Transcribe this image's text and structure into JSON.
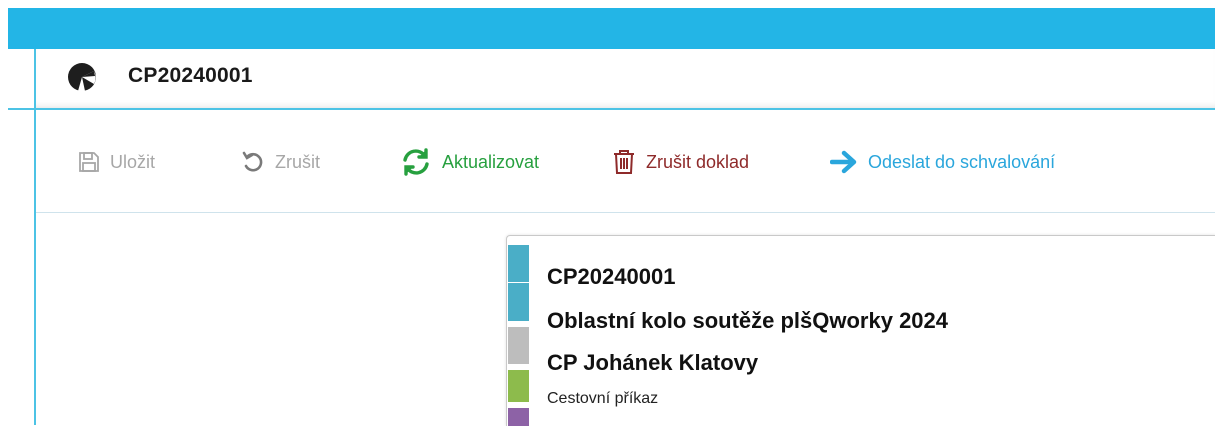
{
  "header": {
    "document_title": "CP20240001",
    "logo_icon": "company-logo-icon"
  },
  "toolbar": {
    "save_label": "Uložit",
    "cancel_label": "Zrušit",
    "refresh_label": "Aktualizovat",
    "delete_label": "Zrušit doklad",
    "send_label": "Odeslat do schvalování",
    "colors": {
      "disabled": "#a7a7a7",
      "refresh": "#27a03f",
      "delete": "#8e2a2a",
      "send": "#2aa6dc"
    }
  },
  "card": {
    "code": "CP20240001",
    "name": "Oblastní kolo soutěže plšQworky 2024",
    "organization": "CP Johánek Klatovy",
    "type": "Cestovní příkaz",
    "stripe_colors": [
      "#4aaec7",
      "#4aaec7",
      "#bdbdbd",
      "#8dbb4c",
      "#8d62a6"
    ]
  },
  "theme": {
    "accent": "#23b5e6"
  }
}
